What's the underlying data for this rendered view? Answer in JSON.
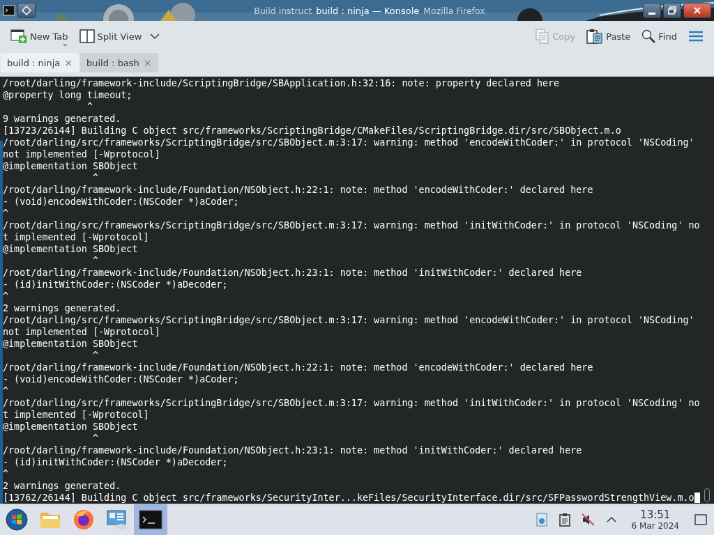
{
  "window": {
    "background_title_parts": [
      "Build instruct",
      "Mozilla Firefox"
    ],
    "title": "build : ninja — Konsole"
  },
  "toolbar": [
    {
      "kind": "new_tab",
      "label": "New Tab",
      "disabled": false
    },
    {
      "kind": "split_view",
      "label": "Split View",
      "disabled": false
    },
    {
      "kind": "copy",
      "label": "Copy",
      "disabled": true
    },
    {
      "kind": "paste",
      "label": "Paste",
      "disabled": false
    },
    {
      "kind": "find",
      "label": "Find",
      "disabled": false
    },
    {
      "kind": "menu",
      "disabled": false
    }
  ],
  "tabs": [
    {
      "label": "build : ninja",
      "close": "×",
      "selected": true
    },
    {
      "label": "build : bash",
      "close": "×",
      "selected": false
    }
  ],
  "terminal": {
    "lines": [
      "/root/darling/framework-include/ScriptingBridge/SBApplication.h:32:16: note: property declared here",
      "@property long timeout;",
      "               ^",
      "9 warnings generated.",
      "[13723/26144] Building C object src/frameworks/ScriptingBridge/CMakeFiles/ScriptingBridge.dir/src/SBObject.m.o",
      "/root/darling/src/frameworks/ScriptingBridge/src/SBObject.m:3:17: warning: method 'encodeWithCoder:' in protocol 'NSCoding'",
      "not implemented [-Wprotocol]",
      "@implementation SBObject",
      "                ^",
      "/root/darling/framework-include/Foundation/NSObject.h:22:1: note: method 'encodeWithCoder:' declared here",
      "- (void)encodeWithCoder:(NSCoder *)aCoder;",
      "^",
      "/root/darling/src/frameworks/ScriptingBridge/src/SBObject.m:3:17: warning: method 'initWithCoder:' in protocol 'NSCoding' no",
      "t implemented [-Wprotocol]",
      "@implementation SBObject",
      "                ^",
      "/root/darling/framework-include/Foundation/NSObject.h:23:1: note: method 'initWithCoder:' declared here",
      "- (id)initWithCoder:(NSCoder *)aDecoder;",
      "^",
      "2 warnings generated.",
      "/root/darling/src/frameworks/ScriptingBridge/src/SBObject.m:3:17: warning: method 'encodeWithCoder:' in protocol 'NSCoding'",
      "not implemented [-Wprotocol]",
      "@implementation SBObject",
      "                ^",
      "/root/darling/framework-include/Foundation/NSObject.h:22:1: note: method 'encodeWithCoder:' declared here",
      "- (void)encodeWithCoder:(NSCoder *)aCoder;",
      "^",
      "/root/darling/src/frameworks/ScriptingBridge/src/SBObject.m:3:17: warning: method 'initWithCoder:' in protocol 'NSCoding' no",
      "t implemented [-Wprotocol]",
      "@implementation SBObject",
      "                ^",
      "/root/darling/framework-include/Foundation/NSObject.h:23:1: note: method 'initWithCoder:' declared here",
      "- (id)initWithCoder:(NSCoder *)aDecoder;",
      "^",
      "2 warnings generated.",
      "[13762/26144] Building C object src/frameworks/SecurityInter...keFiles/SecurityInterface.dir/src/SFPasswordStrengthView.m.o"
    ]
  },
  "taskbar": {
    "apps": [
      {
        "kind": "start",
        "selected": false
      },
      {
        "kind": "files",
        "selected": false
      },
      {
        "kind": "browser",
        "selected": false
      },
      {
        "kind": "settings",
        "selected": false
      },
      {
        "kind": "terminal",
        "selected": true
      }
    ],
    "tray": [
      {
        "kind": "updates"
      },
      {
        "kind": "clipboard"
      },
      {
        "kind": "volume",
        "muted": true
      },
      {
        "kind": "expand"
      }
    ],
    "clock": {
      "time": "13:51",
      "date": "6 Mar 2024"
    }
  }
}
